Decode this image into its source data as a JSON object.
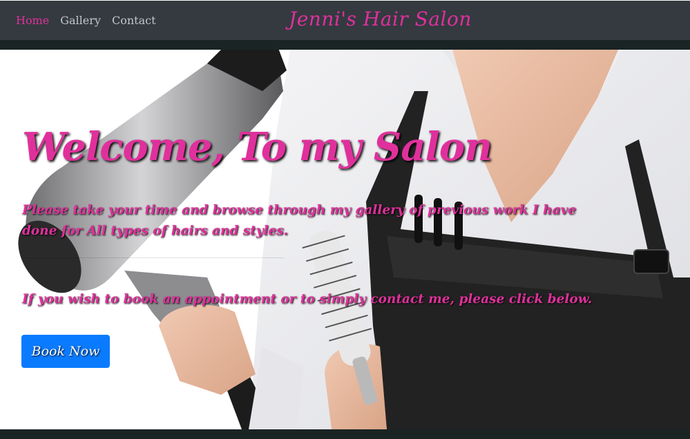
{
  "nav": {
    "links": [
      {
        "label": "Home",
        "active": true
      },
      {
        "label": "Gallery",
        "active": false
      },
      {
        "label": "Contact",
        "active": false
      }
    ],
    "brand": "Jenni's Hair Salon"
  },
  "hero": {
    "title": "Welcome, To my Salon",
    "text1": "Please take your time and browse through my gallery of previous work I have done for All types of hairs and styles.",
    "text2": "If you wish to book an appointment or to simply contact me, please click below.",
    "button_label": "Book Now"
  },
  "colors": {
    "accent": "#e0309c",
    "navbar_bg": "#343a40",
    "nav_link": "#c3c6c9",
    "button_bg": "#0a7bff"
  },
  "icons": [
    "hair-dryer-image",
    "round-brush-image",
    "apron-image"
  ]
}
